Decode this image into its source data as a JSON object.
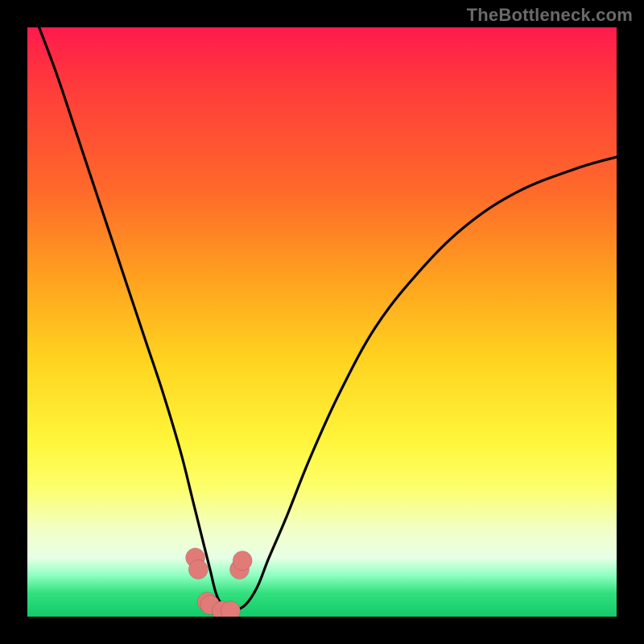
{
  "watermark": "TheBottleneck.com",
  "chart_data": {
    "type": "line",
    "title": "",
    "xlabel": "",
    "ylabel": "",
    "xlim": [
      0,
      100
    ],
    "ylim": [
      0,
      100
    ],
    "series": [
      {
        "name": "bottleneck-curve",
        "x": [
          2,
          5,
          8,
          11,
          14,
          17,
          20,
          23,
          26,
          28,
          30,
          31,
          32,
          33,
          34,
          35,
          37,
          39,
          41,
          44,
          48,
          53,
          59,
          66,
          74,
          83,
          93,
          100
        ],
        "values": [
          100,
          92,
          83,
          74,
          65,
          56,
          47,
          38,
          28,
          20,
          12,
          8,
          4,
          2,
          1,
          1,
          2,
          5,
          10,
          17,
          27,
          38,
          49,
          58,
          66,
          72,
          76,
          78
        ]
      }
    ],
    "dip_markers": {
      "x": [
        28.5,
        29.0,
        30.5,
        31.0,
        33.0,
        34.5,
        36.0,
        36.5
      ],
      "values": [
        10.0,
        8.0,
        2.5,
        2.0,
        1.0,
        1.0,
        8.0,
        9.5
      ]
    },
    "background_gradient": [
      "#ff1a4d",
      "#ffd21f",
      "#fff53a",
      "#13c96a"
    ]
  }
}
